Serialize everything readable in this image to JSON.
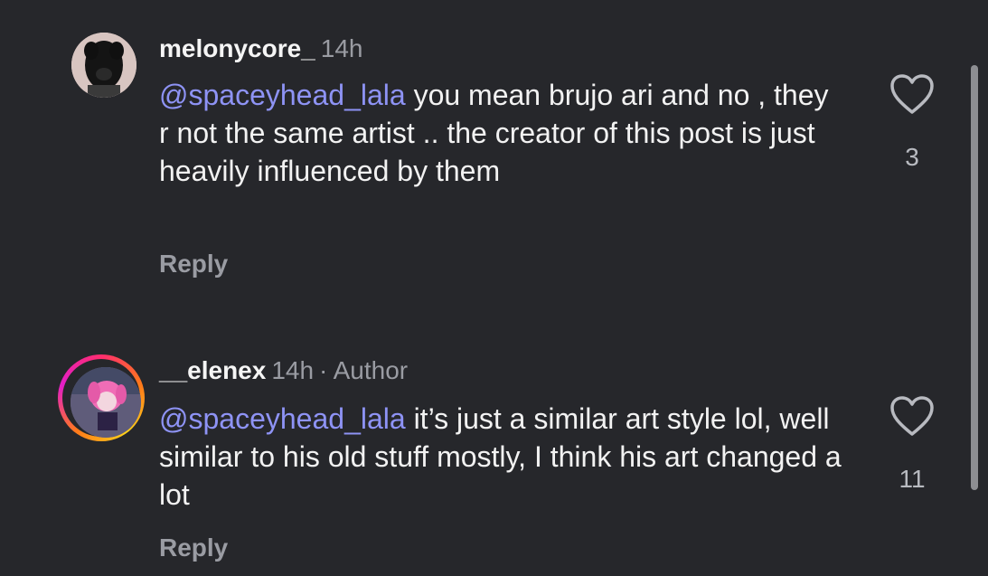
{
  "comments": [
    {
      "username": "melonycore_",
      "time": "14h",
      "mention": "@spaceyhead_lala",
      "text": " you mean brujo ari and no , they r not the same artist .. the creator of this post is just heavily influenced by them",
      "reply_label": "Reply",
      "like_count": "3"
    },
    {
      "username": "__elenex",
      "time": "14h",
      "author_badge": "· Author",
      "mention": "@spaceyhead_lala",
      "text": " it’s just a similar art style lol, well similar to his old stuff mostly, I think his art changed a lot",
      "reply_label": "Reply",
      "like_count": "11"
    }
  ],
  "icons": {
    "like": "heart-icon"
  },
  "colors": {
    "background": "#26272b",
    "mention": "#8e93f5",
    "muted": "#9a9ca3"
  }
}
